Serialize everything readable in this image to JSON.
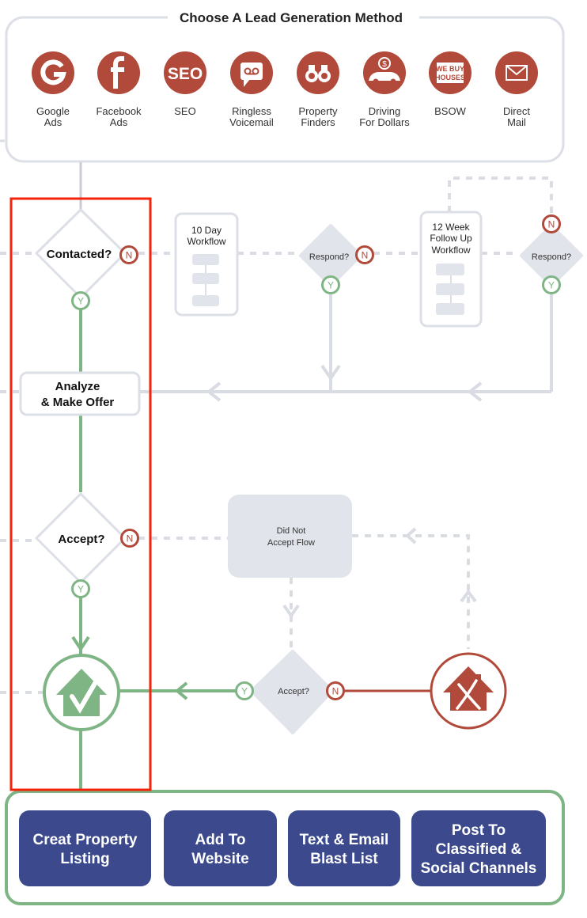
{
  "colors": {
    "red": "#b24a3b",
    "green": "#7fb585",
    "gray_line": "#d9dce3",
    "gray_fill": "#e1e4ea",
    "navy": "#3c4a8d",
    "highlight": "#f5230b"
  },
  "lead_panel": {
    "title": "Choose A Lead Generation Method",
    "methods": [
      {
        "icon": "google-icon",
        "line1": "Google",
        "line2": "Ads"
      },
      {
        "icon": "facebook-icon",
        "line1": "Facebook",
        "line2": "Ads"
      },
      {
        "icon": "seo-icon",
        "line1": "SEO",
        "line2": ""
      },
      {
        "icon": "voicemail-icon",
        "line1": "Ringless",
        "line2": "Voicemail"
      },
      {
        "icon": "binoculars-icon",
        "line1": "Property",
        "line2": "Finders"
      },
      {
        "icon": "car-dollar-icon",
        "line1": "Driving",
        "line2": "For Dollars"
      },
      {
        "icon": "we-buy-houses-icon",
        "line1": "BSOW",
        "line2": ""
      },
      {
        "icon": "mail-icon",
        "line1": "Direct",
        "line2": "Mail"
      }
    ],
    "seo_glyph": "SEO",
    "wbh_line1": "WE BUY",
    "wbh_line2": "HOUSES"
  },
  "flow": {
    "contacted": "Contacted?",
    "ten_day": {
      "line1": "10 Day",
      "line2": "Workflow"
    },
    "respond1": "Respond?",
    "twelve_week": {
      "line1": "12 Week",
      "line2": "Follow Up",
      "line3": "Workflow"
    },
    "respond2": "Respond?",
    "analyze": {
      "line1": "Analyze",
      "line2": "& Make Offer"
    },
    "accept1": "Accept?",
    "did_not_accept": {
      "line1": "Did Not",
      "line2": "Accept Flow"
    },
    "accept2": "Accept?",
    "yes": "Y",
    "no": "N"
  },
  "actions": [
    {
      "line1": "Creat Property",
      "line2": "Listing",
      "line3": ""
    },
    {
      "line1": "Add To",
      "line2": "Website",
      "line3": ""
    },
    {
      "line1": "Text & Email",
      "line2": "Blast List",
      "line3": ""
    },
    {
      "line1": "Post To",
      "line2": "Classified &",
      "line3": "Social Channels"
    }
  ]
}
